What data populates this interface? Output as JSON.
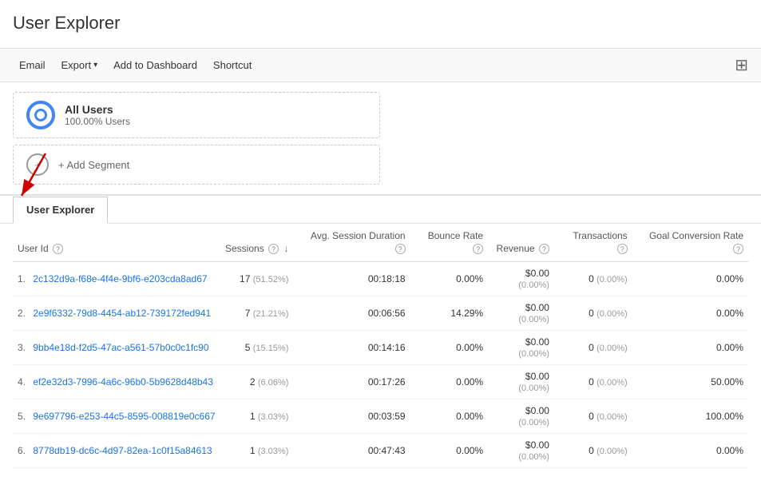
{
  "page": {
    "title": "User Explorer"
  },
  "toolbar": {
    "email": "Email",
    "export": "Export",
    "add_to_dashboard": "Add to Dashboard",
    "shortcut": "Shortcut"
  },
  "segment": {
    "name": "All Users",
    "sub": "100.00% Users",
    "add_label": "+ Add Segment"
  },
  "tabs": [
    {
      "label": "User Explorer",
      "active": true
    }
  ],
  "table": {
    "columns": [
      {
        "id": "user_id",
        "label": "User Id",
        "has_help": true,
        "align": "left"
      },
      {
        "id": "sessions",
        "label": "Sessions",
        "has_help": true,
        "sort": true,
        "align": "right"
      },
      {
        "id": "avg_session",
        "label": "Avg. Session Duration",
        "has_help": true,
        "align": "right"
      },
      {
        "id": "bounce_rate",
        "label": "Bounce Rate",
        "has_help": true,
        "align": "right"
      },
      {
        "id": "revenue",
        "label": "Revenue",
        "has_help": true,
        "align": "right"
      },
      {
        "id": "transactions",
        "label": "Transactions",
        "has_help": true,
        "align": "right"
      },
      {
        "id": "goal_conversion",
        "label": "Goal Conversion Rate",
        "has_help": true,
        "align": "right"
      }
    ],
    "rows": [
      {
        "num": "1.",
        "user_id": "2c132d9a-f68e-4f4e-9bf6-e203cda8ad67",
        "sessions": "17",
        "sessions_pct": "51.52%",
        "avg_session": "00:18:18",
        "bounce_rate": "0.00%",
        "revenue": "$0.00",
        "revenue_pct": "0.00%",
        "transactions": "0",
        "transactions_pct": "0.00%",
        "goal_conversion": "0.00%"
      },
      {
        "num": "2.",
        "user_id": "2e9f6332-79d8-4454-ab12-739172fed941",
        "sessions": "7",
        "sessions_pct": "21.21%",
        "avg_session": "00:06:56",
        "bounce_rate": "14.29%",
        "revenue": "$0.00",
        "revenue_pct": "0.00%",
        "transactions": "0",
        "transactions_pct": "0.00%",
        "goal_conversion": "0.00%"
      },
      {
        "num": "3.",
        "user_id": "9bb4e18d-f2d5-47ac-a561-57b0c0c1fc90",
        "sessions": "5",
        "sessions_pct": "15.15%",
        "avg_session": "00:14:16",
        "bounce_rate": "0.00%",
        "revenue": "$0.00",
        "revenue_pct": "0.00%",
        "transactions": "0",
        "transactions_pct": "0.00%",
        "goal_conversion": "0.00%"
      },
      {
        "num": "4.",
        "user_id": "ef2e32d3-7996-4a6c-96b0-5b9628d48b43",
        "sessions": "2",
        "sessions_pct": "6.06%",
        "avg_session": "00:17:26",
        "bounce_rate": "0.00%",
        "revenue": "$0.00",
        "revenue_pct": "0.00%",
        "transactions": "0",
        "transactions_pct": "0.00%",
        "goal_conversion": "50.00%"
      },
      {
        "num": "5.",
        "user_id": "9e697796-e253-44c5-8595-008819e0c667",
        "sessions": "1",
        "sessions_pct": "3.03%",
        "avg_session": "00:03:59",
        "bounce_rate": "0.00%",
        "revenue": "$0.00",
        "revenue_pct": "0.00%",
        "transactions": "0",
        "transactions_pct": "0.00%",
        "goal_conversion": "100.00%"
      },
      {
        "num": "6.",
        "user_id": "8778db19-dc6c-4d97-82ea-1c0f15a84613",
        "sessions": "1",
        "sessions_pct": "3.03%",
        "avg_session": "00:47:43",
        "bounce_rate": "0.00%",
        "revenue": "$0.00",
        "revenue_pct": "0.00%",
        "transactions": "0",
        "transactions_pct": "0.00%",
        "goal_conversion": "0.00%"
      }
    ]
  }
}
